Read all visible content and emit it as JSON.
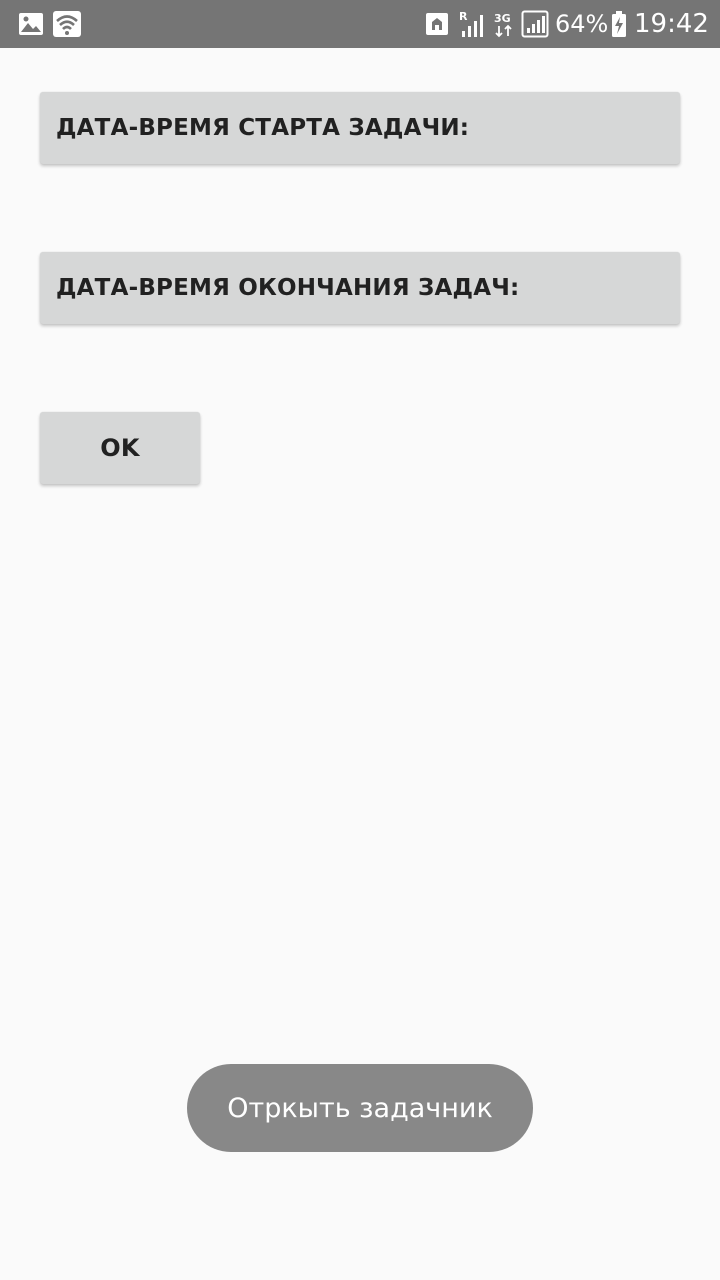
{
  "status_bar": {
    "battery_percent": "64%",
    "time": "19:42",
    "icons": [
      "gallery-icon",
      "wifi-icon",
      "save-indicator-icon",
      "signal-roaming-icon",
      "network-3g-icon",
      "signal-strength-icon",
      "battery-charging-icon"
    ],
    "roaming_label": "R",
    "network_label": "3G",
    "background_color": "#757575"
  },
  "buttons": {
    "start_datetime_label": "ДАТА-ВРЕМЯ СТАРТА ЗАДАЧИ:",
    "end_datetime_label": "ДАТА-ВРЕМЯ ОКОНЧАНИЯ ЗАДАЧ:",
    "ok_label": "OK",
    "background_color": "#d6d7d7"
  },
  "toast": {
    "text": "Отркыть задачник",
    "background_color": "#888888"
  },
  "screen_background": "#fafafa"
}
